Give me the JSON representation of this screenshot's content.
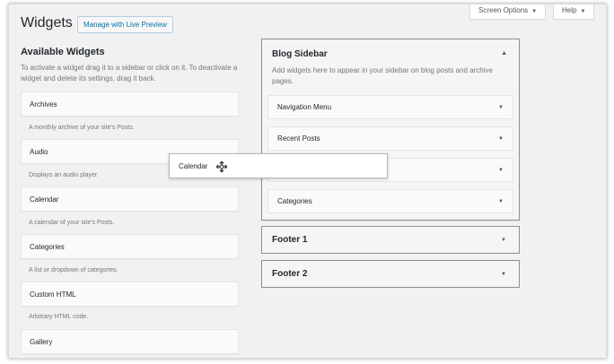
{
  "header": {
    "title": "Widgets",
    "manage_button": "Manage with Live Preview",
    "screen_options": "Screen Options",
    "help": "Help",
    "dropdown_glyph": "▼"
  },
  "available": {
    "title": "Available Widgets",
    "description": "To activate a widget drag it to a sidebar or click on it. To deactivate a widget and delete its settings, drag it back.",
    "widgets": [
      {
        "title": "Archives",
        "description": "A monthly archive of your site's Posts."
      },
      {
        "title": "Audio",
        "description": "Displays an audio player."
      },
      {
        "title": "Calendar",
        "description": "A calendar of your site's Posts."
      },
      {
        "title": "Categories",
        "description": "A list or dropdown of categories."
      },
      {
        "title": "Custom HTML",
        "description": "Arbitrary HTML code."
      },
      {
        "title": "Gallery",
        "description": ""
      }
    ]
  },
  "blog_sidebar": {
    "title": "Blog Sidebar",
    "description": "Add widgets here to appear in your sidebar on blog posts and archive pages.",
    "widgets": [
      "Navigation Menu",
      "Recent Posts",
      "",
      "Categories"
    ]
  },
  "footers": [
    "Footer 1",
    "Footer 2"
  ],
  "dragging": {
    "title": "Calendar",
    "icon": "move-icon"
  },
  "glyphs": {
    "expand": "▼",
    "collapse": "▲"
  },
  "colors": {
    "link": "#0073aa",
    "background": "#f1f1f1",
    "text": "#23282d",
    "muted": "#72777c"
  }
}
